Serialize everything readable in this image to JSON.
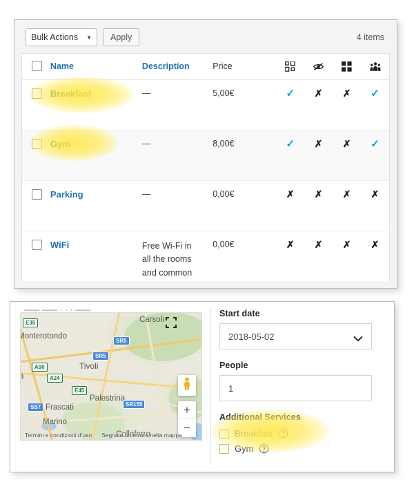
{
  "services_panel": {
    "toolbar": {
      "bulk_actions_label": "Bulk Actions",
      "caret_icon": "caret-down-icon",
      "apply_label": "Apply",
      "items_count": "4 items"
    },
    "table": {
      "columns": {
        "select_all": "",
        "name": "Name",
        "description": "Description",
        "price": "Price",
        "icon_1": "qr-grid-icon",
        "icon_2": "eye-slash-icon",
        "icon_3": "grid-2x2-icon",
        "icon_4": "group-users-icon"
      },
      "rows": [
        {
          "name": "Breakfast",
          "description": "—",
          "price": "5,00€",
          "flags": [
            "check",
            "cross",
            "cross",
            "check"
          ],
          "highlighted": true
        },
        {
          "name": "Gym",
          "description": "—",
          "price": "8,00€",
          "flags": [
            "check",
            "cross",
            "cross",
            "check"
          ],
          "highlighted": true
        },
        {
          "name": "Parking",
          "description": "—",
          "price": "0,00€",
          "flags": [
            "cross",
            "cross",
            "cross",
            "cross"
          ],
          "highlighted": false
        },
        {
          "name": "WiFi",
          "description": "Free Wi-Fi in all the rooms and common areas.",
          "price": "0,00€",
          "flags": [
            "cross",
            "cross",
            "cross",
            "cross"
          ],
          "highlighted": false
        }
      ]
    }
  },
  "booking_panel": {
    "map": {
      "clipped_header": "——  ——  · · ·  ——",
      "fullscreen_icon": "fullscreen-expand-icon",
      "pegman_icon": "street-view-pegman-icon",
      "zoom_in_label": "+",
      "zoom_out_label": "−",
      "terms_label": "Termini e condizioni d'uso",
      "report_label": "Segnala un errore nella mappa",
      "places": [
        "Carsoli",
        "Monterotondo",
        "Tivoli",
        "Palestrina",
        "Frascati",
        "Marino",
        "Colleferro"
      ],
      "roads": [
        "E35",
        "SR5",
        "SR5",
        "A90",
        "A24",
        "E45",
        "SS7",
        "SR155"
      ]
    },
    "form": {
      "start_date_label": "Start date",
      "start_date_value": "2018-05-02",
      "chevron_icon": "chevron-down-icon",
      "people_label": "People",
      "people_value": "1",
      "services_label": "Additional Services",
      "services": [
        {
          "label": "Breakfast",
          "help_icon": "help-circle-icon",
          "checked": false
        },
        {
          "label": "Gym",
          "help_icon": "help-circle-icon",
          "checked": false
        }
      ]
    }
  },
  "colors": {
    "link_blue": "#2271b1",
    "highlight_green": "#14532d",
    "check_cyan": "#00a0d2",
    "cross_dark": "#1d2327",
    "glow_yellow": "#ffe850",
    "panel_bg": "#f4f4f4"
  }
}
